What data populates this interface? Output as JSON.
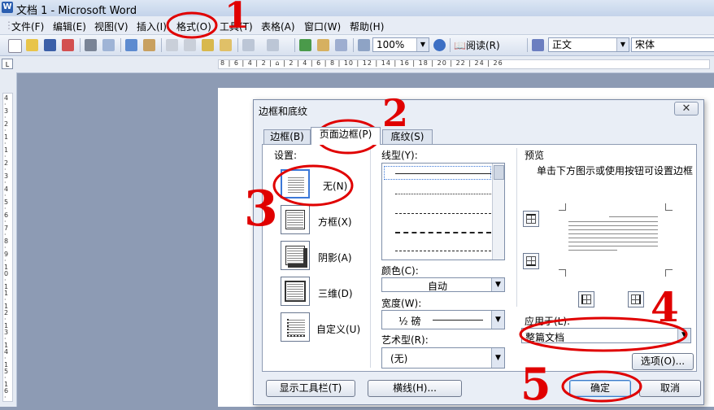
{
  "window": {
    "title": "文档 1 - Microsoft Word"
  },
  "menu": [
    "文件(F)",
    "编辑(E)",
    "视图(V)",
    "插入(I)",
    "格式(O)",
    "工具(T)",
    "表格(A)",
    "窗口(W)",
    "帮助(H)"
  ],
  "toolbar": {
    "zoom": "100%",
    "read_label": "阅读(R)",
    "style": "正文",
    "font": "宋体"
  },
  "ruler": {
    "corner": "L",
    "marks": "8 | 6 | 4 | 2 | ⌂ | 2 | 4 | 6 | 8 | 10 | 12 | 14 | 16 | 18 | 20 | 22 | 24 | 26",
    "vmarks": "4 · 3 · 2 · 1 · 1 · 2 · 3 · 4 · 5 · 6 · 7 · 8 · 9 · 10 · 11 · 12 · 13 · 14 · 15 · 16 · 17 · 18 · 19 · 20"
  },
  "dialog": {
    "title": "边框和底纹",
    "close_glyph": "✕",
    "tabs": [
      "边框(B)",
      "页面边框(P)",
      "底纹(S)"
    ],
    "settings_label": "设置:",
    "settings": [
      "无(N)",
      "方框(X)",
      "阴影(A)",
      "三维(D)",
      "自定义(U)"
    ],
    "line_style_label": "线型(Y):",
    "color_label": "颜色(C):",
    "color_value": "自动",
    "width_label": "宽度(W):",
    "width_value": "½ 磅",
    "art_label": "艺术型(R):",
    "art_value": "(无)",
    "preview_label": "预览",
    "preview_hint": "单击下方图示或使用按钮可设置边框",
    "apply_label": "应用于(L):",
    "apply_value": "整篇文档",
    "options_button": "选项(O)...",
    "toolbar_button": "显示工具栏(T)",
    "hline_button": "横线(H)...",
    "ok_button": "确定",
    "cancel_button": "取消"
  },
  "annotations": [
    "1",
    "2",
    "3",
    "4",
    "5"
  ],
  "colors": {
    "annotation": "#e00000",
    "selection": "#3b78d8"
  }
}
